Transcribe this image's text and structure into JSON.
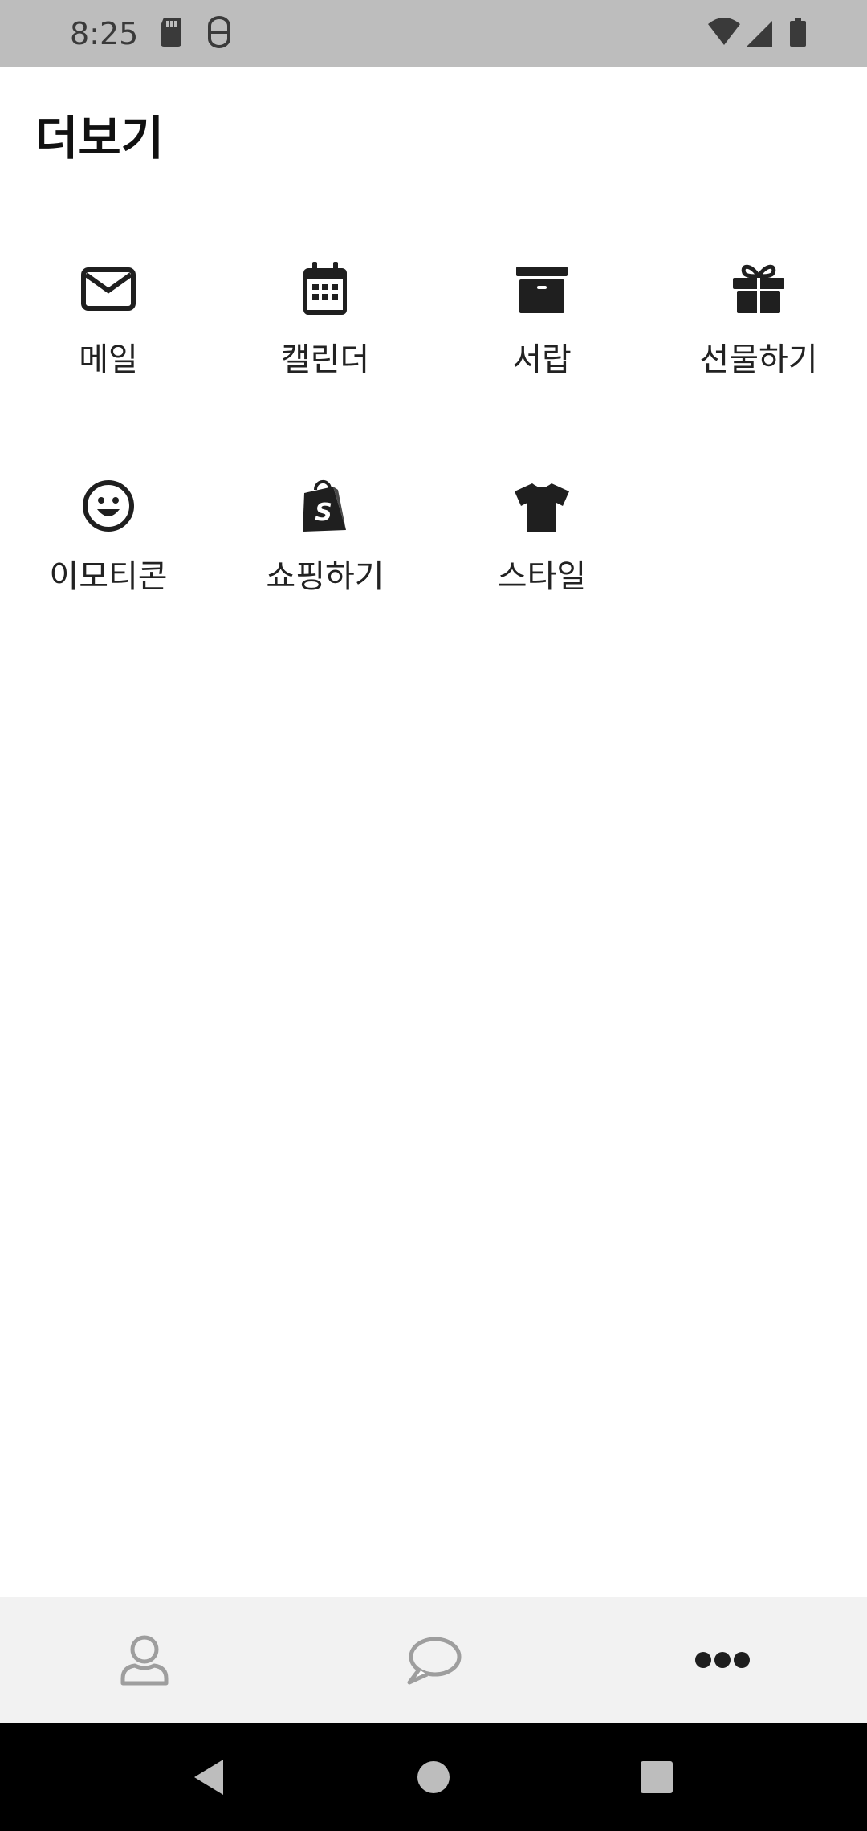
{
  "status_bar": {
    "time": "8:25",
    "icons": [
      "sd-card-icon",
      "privacy-icon",
      "wifi-icon",
      "signal-icon",
      "battery-icon"
    ]
  },
  "page": {
    "title": "더보기"
  },
  "menu": [
    {
      "label": "메일",
      "icon": "mail-icon"
    },
    {
      "label": "캘린더",
      "icon": "calendar-icon"
    },
    {
      "label": "서랍",
      "icon": "archive-icon"
    },
    {
      "label": "선물하기",
      "icon": "gift-icon"
    },
    {
      "label": "이모티콘",
      "icon": "smile-icon"
    },
    {
      "label": "쇼핑하기",
      "icon": "shopping-bag-icon"
    },
    {
      "label": "스타일",
      "icon": "tshirt-icon"
    }
  ],
  "bottom_nav": {
    "items": [
      "profile-icon",
      "chat-icon",
      "more-icon"
    ],
    "active": "more-icon"
  },
  "system_nav": {
    "items": [
      "back-icon",
      "home-icon",
      "recents-icon"
    ]
  },
  "colors": {
    "status_bar": "#bdbdbd",
    "bottom_nav": "#f2f2f2",
    "icon_dark": "#1f1f1f",
    "icon_inactive": "#9e9e9e",
    "system_nav": "#000000"
  }
}
